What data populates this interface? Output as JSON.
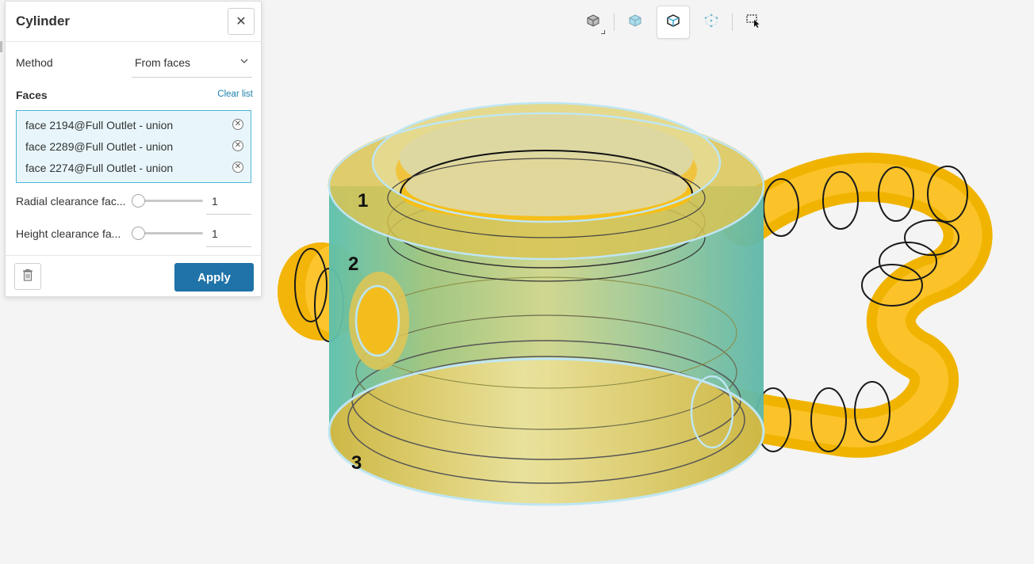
{
  "panel": {
    "title": "Cylinder",
    "method_label": "Method",
    "method_value": "From faces",
    "faces_label": "Faces",
    "clear_list_label": "Clear list",
    "faces": [
      "face 2194@Full Outlet - union",
      "face 2289@Full Outlet - union",
      "face 2274@Full Outlet - union"
    ],
    "radial_label": "Radial clearance fac...",
    "radial_value": "1",
    "height_label": "Height clearance fa...",
    "height_value": "1",
    "apply_label": "Apply"
  },
  "viewport": {
    "annotations": [
      "1",
      "2",
      "3"
    ]
  },
  "toolbar": {
    "icons": [
      "view-cube-icon",
      "solid-view-icon",
      "wireframe-edges-icon",
      "points-view-icon",
      "box-select-icon"
    ]
  },
  "colors": {
    "accent": "#1f73a8",
    "selection_border": "#4fb4d8",
    "model_yellow": "#f7c01c",
    "model_teal": "#5fb8aa"
  }
}
